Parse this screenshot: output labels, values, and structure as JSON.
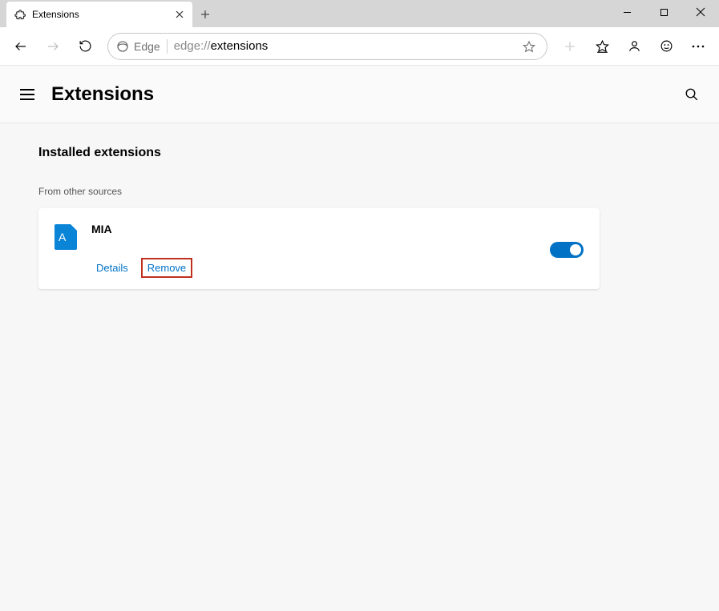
{
  "window": {
    "tab_title": "Extensions",
    "address_label": "Edge",
    "url_proto": "edge://",
    "url_path": "extensions"
  },
  "page": {
    "title": "Extensions"
  },
  "section": {
    "installed_title": "Installed extensions",
    "source_label": "From other sources"
  },
  "extension": {
    "icon_letter": "A",
    "name": "MIA",
    "details_label": "Details",
    "remove_label": "Remove",
    "enabled": true
  }
}
